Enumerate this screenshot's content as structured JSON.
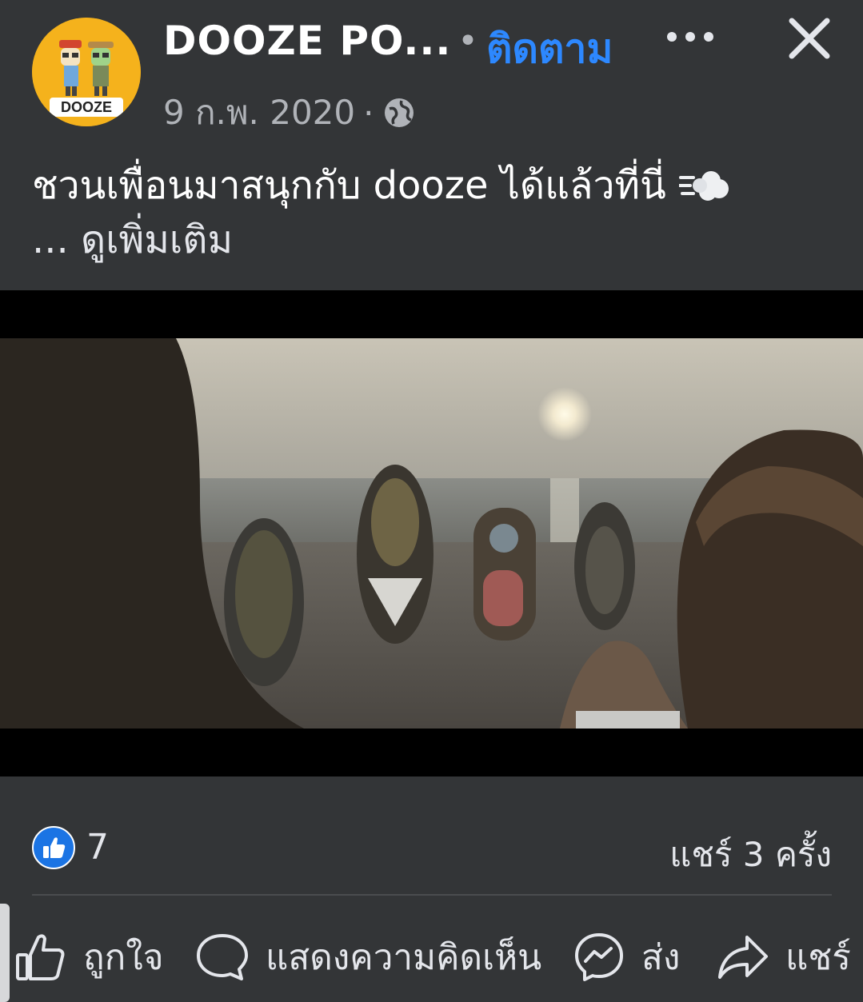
{
  "header": {
    "page_name": "DOOZE  PO...",
    "separator": "•",
    "follow_label": "ติดตาม",
    "avatar_text": "DOOZE",
    "date": "9 ก.พ. 2020",
    "meta_separator": "·",
    "privacy_icon": "globe-icon",
    "more_icon": "more-dots-icon",
    "close_icon": "close-icon"
  },
  "post": {
    "caption": "ชวนเพื่อนมาสนุกกับ dooze ได้แล้วที่นี่",
    "emoji_icon": "dashing-away-icon",
    "see_more": "... ดูเพิ่มเติม"
  },
  "media": {
    "type": "video",
    "scene": "sunset-beach-surfboards"
  },
  "stats": {
    "like_count": "7",
    "share_count": "แชร์ 3 ครั้ง"
  },
  "actions": [
    {
      "label": "ถูกใจ",
      "icon": "thumbs-up-icon"
    },
    {
      "label": "แสดงความคิดเห็น",
      "icon": "comment-icon"
    },
    {
      "label": "ส่ง",
      "icon": "messenger-icon"
    },
    {
      "label": "แชร์",
      "icon": "share-arrow-icon"
    }
  ],
  "colors": {
    "background": "#333537",
    "link": "#2d88ff",
    "text": "#e4e6eb",
    "secondary_text": "#b0b3b8",
    "avatar_bg": "#f5b21c"
  }
}
